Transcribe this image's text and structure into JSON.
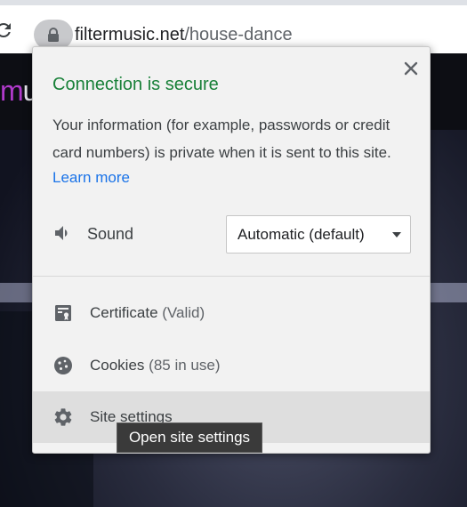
{
  "browser": {
    "domain": "filtermusic.net",
    "path": "/house-dance"
  },
  "page": {
    "logo_prefix": "m",
    "logo_rest": "u"
  },
  "popup": {
    "title": "Connection is secure",
    "description": "Your information (for example, passwords or credit card numbers) is private when it is sent to this site.",
    "learn_more": "Learn more",
    "sound": {
      "label": "Sound",
      "value": "Automatic (default)"
    },
    "certificate": {
      "label": "Certificate",
      "status": "(Valid)"
    },
    "cookies": {
      "label": "Cookies",
      "status": "(85 in use)"
    },
    "site_settings": {
      "label": "Site settings"
    }
  },
  "tooltip": {
    "text": "Open site settings"
  },
  "colors": {
    "secure_green": "#188038",
    "link_blue": "#1a73e8",
    "popup_bg": "#f2f2f2",
    "hover_row": "#dedede"
  },
  "icons": [
    "reload-icon",
    "lock-icon",
    "close-icon",
    "speaker-icon",
    "certificate-icon",
    "cookie-icon",
    "gear-icon",
    "chevron-down-icon"
  ]
}
